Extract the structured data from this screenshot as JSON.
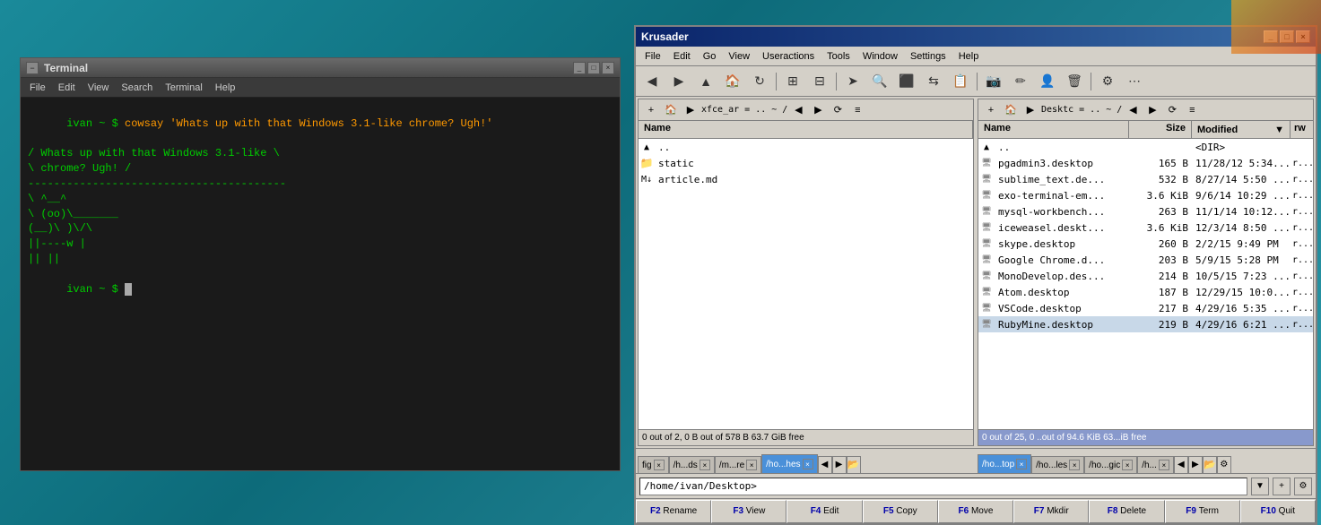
{
  "desktop": {
    "background": "teal gradient"
  },
  "terminal": {
    "title": "Terminal",
    "menu_items": [
      "File",
      "Edit",
      "View",
      "Search",
      "Terminal",
      "Help"
    ],
    "command_line": "ivan ~ $ cowsay 'Whats up with that Windows 3.1-like chrome? Ugh!'",
    "output_lines": [
      " / Whats up with that Windows 3.1-like \\",
      " \\ chrome? Ugh!                         /",
      "  ----------------------------------------",
      "         \\   ^__^",
      "          \\  (oo)\\_______",
      "             (__)\\       )\\/\\",
      "                 ||----w |",
      "                 ||     ||"
    ],
    "prompt_line": "ivan ~ $ "
  },
  "krusader": {
    "title": "Krusader",
    "menu_items": [
      "File",
      "Edit",
      "Go",
      "View",
      "Useractions",
      "Tools",
      "Window",
      "Settings",
      "Help"
    ],
    "left_panel": {
      "path": "xfce_ar = .. ~ /",
      "name_header": "Name",
      "files": [
        {
          "name": "..",
          "icon": "↑",
          "size": "",
          "modified": "",
          "rw": ""
        },
        {
          "name": "static",
          "icon": "📁",
          "size": "",
          "modified": "",
          "rw": ""
        },
        {
          "name": "article.md",
          "icon": "📄",
          "size": "",
          "modified": "",
          "rw": ""
        }
      ],
      "status": "0 out of 2, 0 B out of 578 B     63.7 GiB free"
    },
    "right_panel": {
      "path": "Desktc = .. ~ /",
      "name_header": "Name",
      "size_header": "Size",
      "modified_header": "Modified",
      "rw_header": "rw",
      "files": [
        {
          "name": "..",
          "icon": "↑",
          "size": "",
          "modified": "",
          "rw": "",
          "type": "dir"
        },
        {
          "name": "pgadmin3.desktop",
          "icon": "🖥",
          "size": "165 B",
          "modified": "11/28/12 5:34...",
          "rw": "r..."
        },
        {
          "name": "sublime_text.de...",
          "icon": "🖥",
          "size": "532 B",
          "modified": "8/27/14 5:50 ...",
          "rw": "r..."
        },
        {
          "name": "exo-terminal-em...",
          "icon": "🖥",
          "size": "3.6 KiB",
          "modified": "9/6/14 10:29 ...",
          "rw": "r..."
        },
        {
          "name": "mysql-workbench...",
          "icon": "🖥",
          "size": "263 B",
          "modified": "11/1/14 10:12...",
          "rw": "r..."
        },
        {
          "name": "iceweasel.deskt...",
          "icon": "🖥",
          "size": "3.6 KiB",
          "modified": "12/3/14 8:50 ...",
          "rw": "r..."
        },
        {
          "name": "skype.desktop",
          "icon": "🖥",
          "size": "260 B",
          "modified": "2/2/15 9:49 PM",
          "rw": "r..."
        },
        {
          "name": "Google Chrome.d...",
          "icon": "🖥",
          "size": "203 B",
          "modified": "5/9/15 5:28 PM",
          "rw": "r..."
        },
        {
          "name": "MonoDevelop.des...",
          "icon": "🖥",
          "size": "214 B",
          "modified": "10/5/15 7:23 ...",
          "rw": "r..."
        },
        {
          "name": "Atom.desktop",
          "icon": "🖥",
          "size": "187 B",
          "modified": "12/29/15 10:0...",
          "rw": "r..."
        },
        {
          "name": "VSCode.desktop",
          "icon": "🖥",
          "size": "217 B",
          "modified": "4/29/16 5:35 ...",
          "rw": "r..."
        },
        {
          "name": "RubyMine.desktop",
          "icon": "🖥",
          "size": "219 B",
          "modified": "4/29/16 6:21 ...",
          "rw": "r..."
        }
      ],
      "status": "0 out of 25, 0 ..out of 94.6 KiB     63...iB free"
    },
    "tabs_left": [
      {
        "label": "fig",
        "active": false
      },
      {
        "label": "/h...ds",
        "active": false
      },
      {
        "label": "/m...re",
        "active": false
      },
      {
        "label": "/ho...hes",
        "active": true
      }
    ],
    "tabs_right": [
      {
        "label": "/ho...top",
        "active": true
      },
      {
        "label": "/ho...les",
        "active": false
      },
      {
        "label": "/ho...gic",
        "active": false
      },
      {
        "label": "/h...",
        "active": false
      }
    ],
    "cmdline": "/home/ivan/Desktop>",
    "function_keys": [
      {
        "key": "F2",
        "label": "Rename"
      },
      {
        "key": "F3",
        "label": "View"
      },
      {
        "key": "F4",
        "label": "Edit"
      },
      {
        "key": "F5",
        "label": "Copy"
      },
      {
        "key": "F6",
        "label": "Move"
      },
      {
        "key": "F7",
        "label": "Mkdir"
      },
      {
        "key": "F8",
        "label": "Delete"
      },
      {
        "key": "F9",
        "label": "Term"
      },
      {
        "key": "F10",
        "label": "Quit"
      }
    ]
  }
}
